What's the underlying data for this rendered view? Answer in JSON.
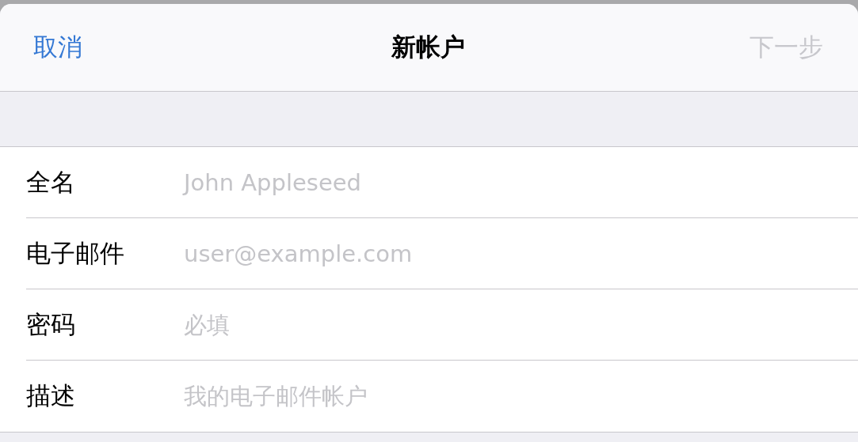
{
  "nav_bar": {
    "cancel": "取消",
    "title": "新帐户",
    "next": {
      "label": "下一步",
      "disabled": true
    }
  },
  "form": {
    "fields": [
      {
        "label": "全名",
        "placeholder": "John Appleseed"
      },
      {
        "label": "电子邮件",
        "placeholder": "user@example.com"
      },
      {
        "label": "密码",
        "placeholder": "必填"
      },
      {
        "label": "描述",
        "placeholder": "我的电子邮件帐户"
      }
    ]
  }
}
